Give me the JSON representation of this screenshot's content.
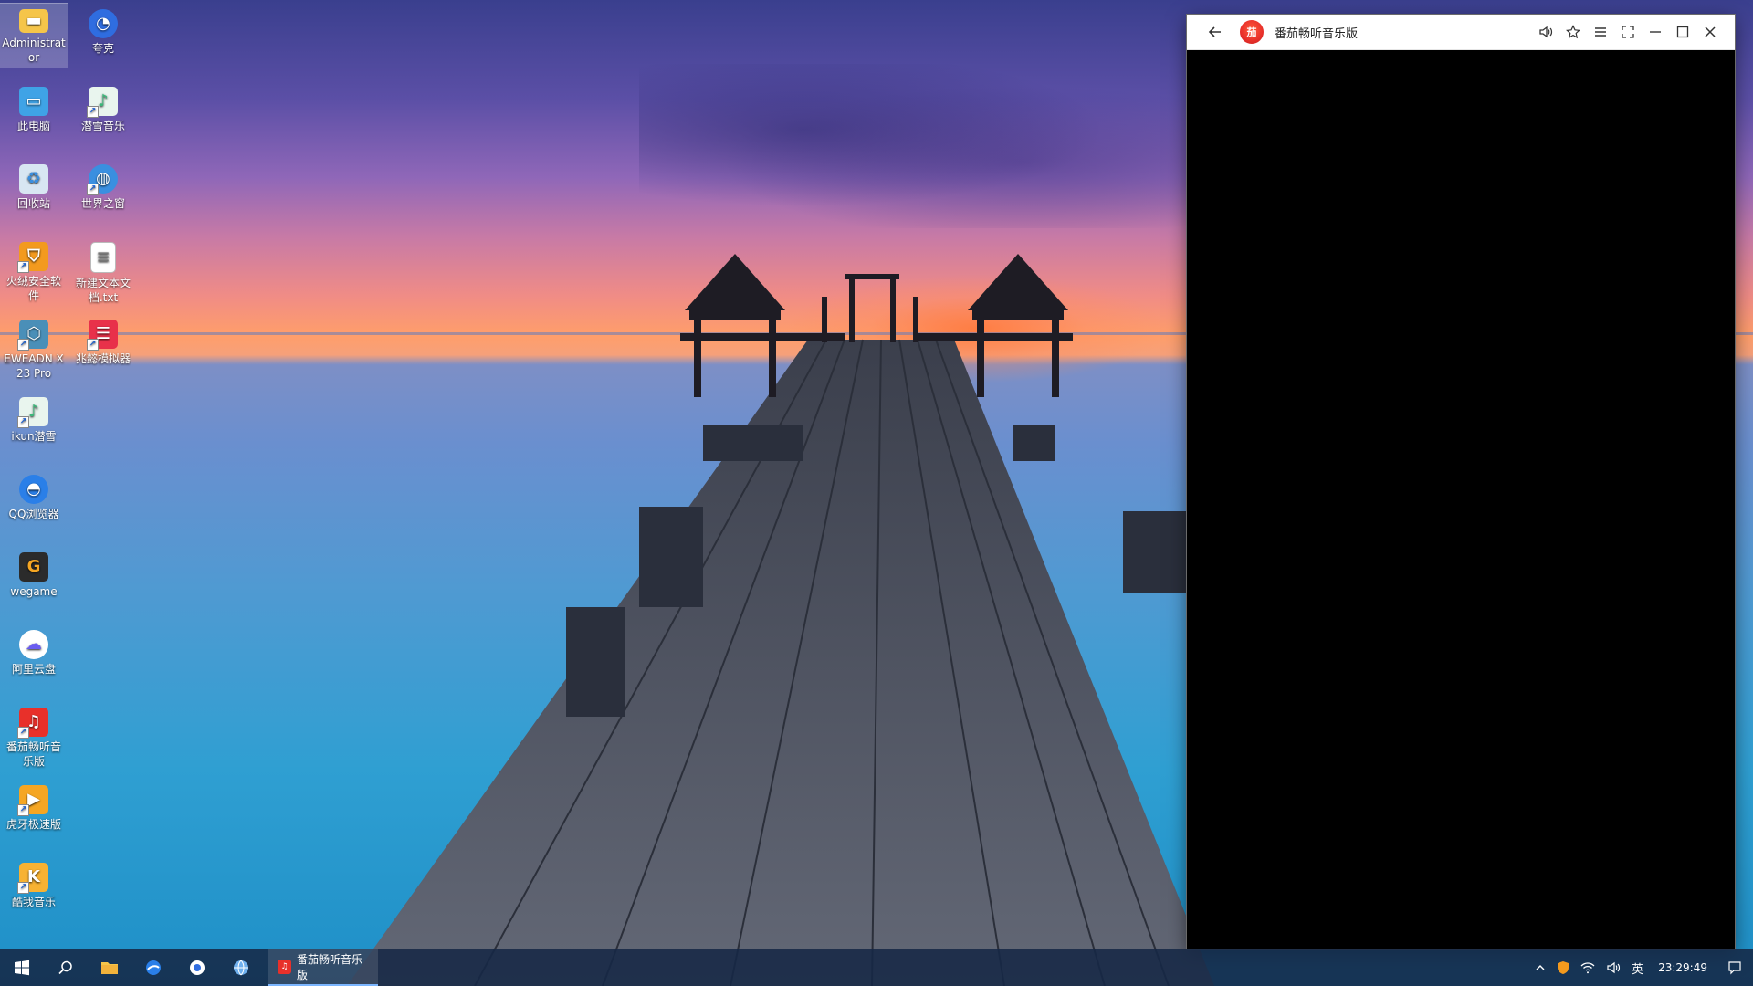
{
  "desktop": {
    "icons": [
      {
        "label": "Administrator",
        "icon": "folder-icon",
        "color": "#f5c54a"
      },
      {
        "label": "夸克",
        "icon": "quark-icon",
        "color": "#2f6de0"
      },
      {
        "label": "此电脑",
        "icon": "computer-icon",
        "color": "#3fa3e6"
      },
      {
        "label": "潜雪音乐",
        "icon": "music-note-icon",
        "color": "#3cb87a"
      },
      {
        "label": "回收站",
        "icon": "recycle-bin-icon",
        "color": "#d8e6f2"
      },
      {
        "label": "世界之窗",
        "icon": "globe-icon",
        "color": "#3a8fe0"
      },
      {
        "label": "火绒安全软件",
        "icon": "fire-shield-icon",
        "color": "#f39a1e"
      },
      {
        "label": "新建文本文档.txt",
        "icon": "text-file-icon",
        "color": "#ffffff"
      },
      {
        "label": "EWEADN X23 Pro",
        "icon": "cube-icon",
        "color": "#4a8fb8"
      },
      {
        "label": "兆懿模拟器",
        "icon": "emulator-icon",
        "color": "#e8314a"
      },
      {
        "label": "ikun潜雪",
        "icon": "music-note-icon",
        "color": "#3cb87a"
      },
      {
        "label": "QQ浏览器",
        "icon": "qq-browser-icon",
        "color": "#2a7fe8"
      },
      {
        "label": "wegame",
        "icon": "wegame-icon",
        "color": "#2b2b2b"
      },
      {
        "label": "阿里云盘",
        "icon": "cloud-drive-icon",
        "color": "#6a5cf0"
      },
      {
        "label": "番茄畅听音乐版",
        "icon": "tomato-music-icon",
        "color": "#e8302a"
      },
      {
        "label": "虎牙极速版",
        "icon": "huya-icon",
        "color": "#f5a623"
      },
      {
        "label": "酷我音乐",
        "icon": "kuwo-music-icon",
        "color": "#f7b233"
      }
    ]
  },
  "window": {
    "title": "番茄畅听音乐版",
    "logo_text": "茄"
  },
  "taskbar": {
    "active_app_label": "番茄畅听音乐版",
    "ime": "英",
    "clock": "23:29:49"
  }
}
